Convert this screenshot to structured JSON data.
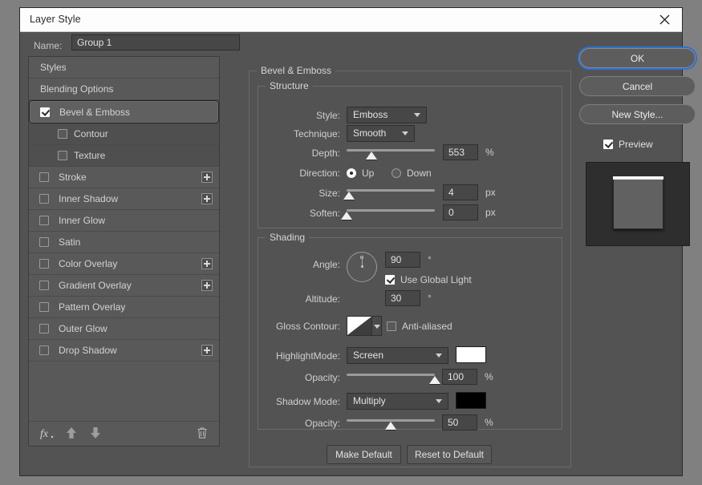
{
  "window": {
    "title": "Layer Style",
    "close_icon": "close-icon"
  },
  "name_field": {
    "label": "Name:",
    "value": "Group 1",
    "placeholder": "Name"
  },
  "styles_panel": {
    "items": [
      {
        "label": "Styles",
        "type": "plain",
        "checkbox": null,
        "plus": false
      },
      {
        "label": "Blending Options",
        "type": "plain",
        "checkbox": null,
        "plus": false
      },
      {
        "label": "Bevel & Emboss",
        "type": "selected",
        "checkbox": true,
        "plus": false
      },
      {
        "label": "Contour",
        "type": "sub",
        "checkbox": false,
        "plus": false
      },
      {
        "label": "Texture",
        "type": "sub",
        "checkbox": false,
        "plus": false
      },
      {
        "label": "Stroke",
        "type": "eff",
        "checkbox": false,
        "plus": true
      },
      {
        "label": "Inner Shadow",
        "type": "eff",
        "checkbox": false,
        "plus": true
      },
      {
        "label": "Inner Glow",
        "type": "eff",
        "checkbox": false,
        "plus": false
      },
      {
        "label": "Satin",
        "type": "eff",
        "checkbox": false,
        "plus": false
      },
      {
        "label": "Color Overlay",
        "type": "eff",
        "checkbox": false,
        "plus": true
      },
      {
        "label": "Gradient Overlay",
        "type": "eff",
        "checkbox": false,
        "plus": true
      },
      {
        "label": "Pattern Overlay",
        "type": "eff",
        "checkbox": false,
        "plus": false
      },
      {
        "label": "Outer Glow",
        "type": "eff",
        "checkbox": false,
        "plus": false
      },
      {
        "label": "Drop Shadow",
        "type": "eff",
        "checkbox": false,
        "plus": true
      }
    ],
    "toolbar": {
      "fx_icon": "fx-icon",
      "up_icon": "arrow-up-icon",
      "down_icon": "arrow-down-icon",
      "trash_icon": "trash-icon"
    }
  },
  "bevel_emboss": {
    "group_title": "Bevel & Emboss",
    "structure": {
      "group_title": "Structure",
      "style": {
        "label": "Style:",
        "value": "Emboss"
      },
      "technique": {
        "label": "Technique:",
        "value": "Smooth"
      },
      "depth": {
        "label": "Depth:",
        "value": "553",
        "unit": "%",
        "slider_pct": 28
      },
      "direction": {
        "label": "Direction:",
        "options": [
          "Up",
          "Down"
        ],
        "selected": "Up"
      },
      "size": {
        "label": "Size:",
        "value": "4",
        "unit": "px",
        "slider_pct": 3
      },
      "soften": {
        "label": "Soften:",
        "value": "0",
        "unit": "px",
        "slider_pct": 0
      }
    },
    "shading": {
      "group_title": "Shading",
      "angle": {
        "label": "Angle:",
        "value": "90",
        "unit": "°"
      },
      "use_global_light": {
        "label": "Use Global Light",
        "checked": true
      },
      "altitude": {
        "label": "Altitude:",
        "value": "30",
        "unit": "°"
      },
      "gloss_contour": {
        "label": "Gloss Contour:",
        "contour": "linear-contour"
      },
      "anti_aliased": {
        "label": "Anti-aliased",
        "checked": false
      },
      "highlight_mode": {
        "label": "HighlightMode:",
        "value": "Screen",
        "color": "#ffffff",
        "opacity": {
          "label": "Opacity:",
          "value": "100",
          "unit": "%",
          "slider_pct": 100
        }
      },
      "shadow_mode": {
        "label": "Shadow Mode:",
        "value": "Multiply",
        "color": "#000000",
        "opacity": {
          "label": "Opacity:",
          "value": "50",
          "unit": "%",
          "slider_pct": 50
        }
      }
    },
    "make_default": "Make Default",
    "reset_to_default": "Reset to Default"
  },
  "right_panel": {
    "ok": "OK",
    "cancel": "Cancel",
    "new_style": "New Style...",
    "preview": {
      "label": "Preview",
      "checked": true
    }
  },
  "colors": {
    "accent": "#2c6fd8",
    "dialog_bg": "#535353",
    "panel_bg": "#595959",
    "field_bg": "#474747",
    "text": "#d2d2d2"
  }
}
